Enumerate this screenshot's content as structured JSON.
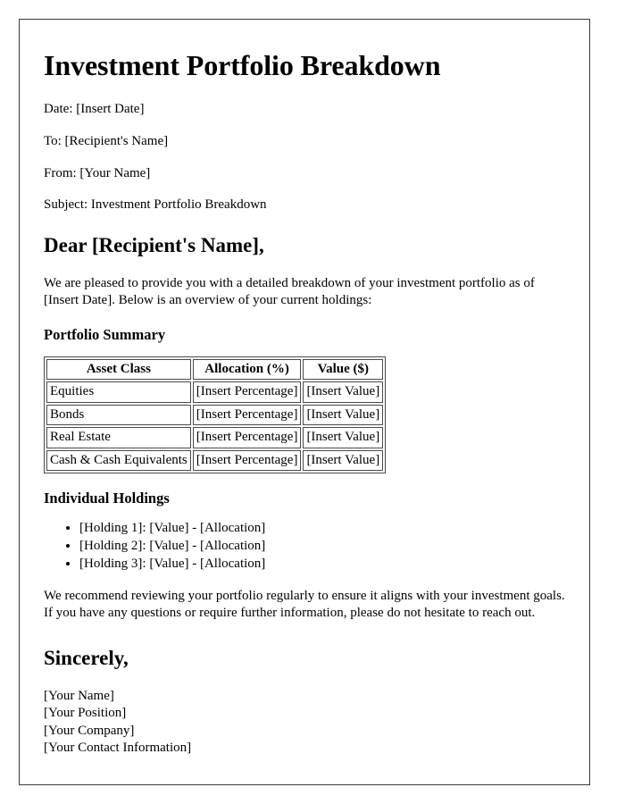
{
  "document": {
    "title": "Investment Portfolio Breakdown",
    "meta": [
      {
        "label": "Date:",
        "value": "[Insert Date]",
        "text": "Date: [Insert Date]"
      },
      {
        "label": "To:",
        "value": "[Recipient's Name]",
        "text": "To: [Recipient's Name]"
      },
      {
        "label": "From:",
        "value": "[Your Name]",
        "text": "From: [Your Name]"
      },
      {
        "label": "Subject:",
        "value": "Investment Portfolio Breakdown",
        "text": "Subject: Investment Portfolio Breakdown"
      }
    ],
    "salutation": "Dear [Recipient's Name],",
    "intro_paragraph": "We are pleased to provide you with a detailed breakdown of your investment portfolio as of [Insert Date]. Below is an overview of your current holdings:",
    "portfolio_summary": {
      "heading": "Portfolio Summary",
      "columns": [
        "Asset Class",
        "Allocation (%)",
        "Value ($)"
      ],
      "rows": [
        [
          "Equities",
          "[Insert Percentage]",
          "[Insert Value]"
        ],
        [
          "Bonds",
          "[Insert Percentage]",
          "[Insert Value]"
        ],
        [
          "Real Estate",
          "[Insert Percentage]",
          "[Insert Value]"
        ],
        [
          "Cash & Cash Equivalents",
          "[Insert Percentage]",
          "[Insert Value]"
        ]
      ]
    },
    "individual_holdings": {
      "heading": "Individual Holdings",
      "items": [
        "[Holding 1]: [Value] - [Allocation]",
        "[Holding 2]: [Value] - [Allocation]",
        "[Holding 3]: [Value] - [Allocation]"
      ]
    },
    "closing_paragraph": "We recommend reviewing your portfolio regularly to ensure it aligns with your investment goals. If you have any questions or require further information, please do not hesitate to reach out.",
    "closing": "Sincerely,",
    "signature": {
      "name": "[Your Name]",
      "position": "[Your Position]",
      "company": "[Your Company]",
      "contact": "[Your Contact Information]"
    }
  },
  "colors": {
    "text": "#000000",
    "page_border": "#3a3a3a",
    "table_border": "#4a4a4a",
    "background": "#ffffff"
  }
}
